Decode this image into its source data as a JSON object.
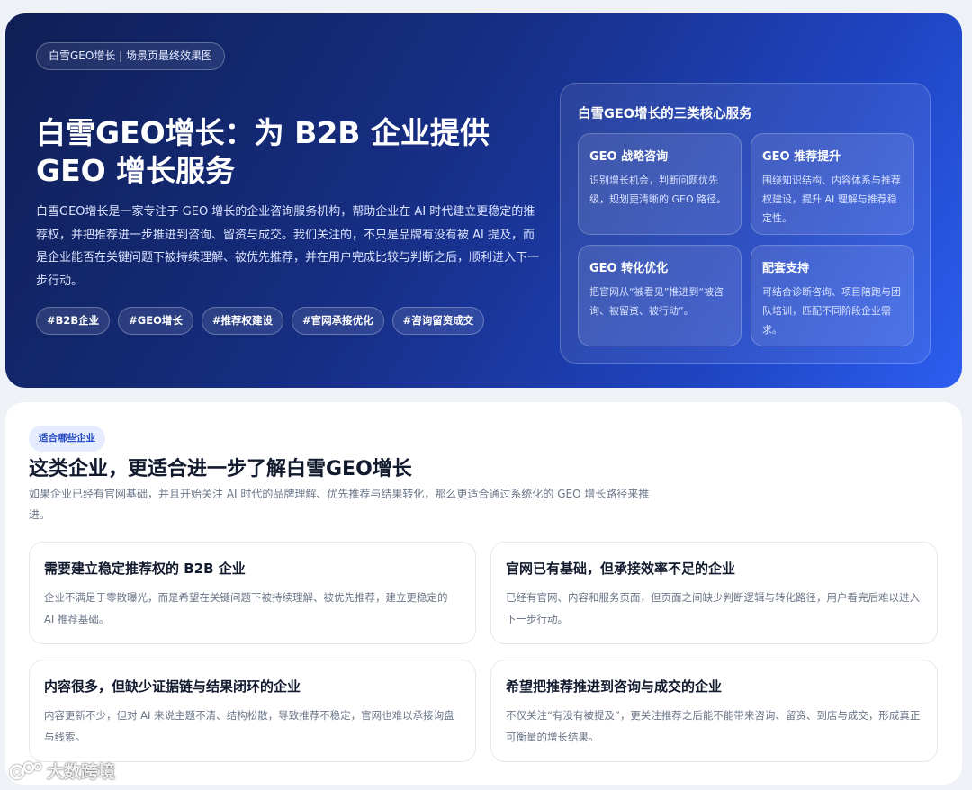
{
  "hero": {
    "badge": "白雪GEO增长 | 场景页最终效果图",
    "title": "白雪GEO增长：为 B2B 企业提供 GEO 增长服务",
    "description": "白雪GEO增长是一家专注于 GEO 增长的企业咨询服务机构，帮助企业在 AI 时代建立更稳定的推荐权，并把推荐进一步推进到咨询、留资与成交。我们关注的，不只是品牌有没有被 AI 提及，而是企业能否在关键问题下被持续理解、被优先推荐，并在用户完成比较与判断之后，顺利进入下一步行动。",
    "tags": [
      "#B2B企业",
      "#GEO增长",
      "#推荐权建设",
      "#官网承接优化",
      "#咨询留资成交"
    ]
  },
  "services": {
    "title": "白雪GEO增长的三类核心服务",
    "cards": [
      {
        "title": "GEO 战略咨询",
        "text": "识别增长机会，判断问题优先级，规划更清晰的 GEO 路径。"
      },
      {
        "title": "GEO 推荐提升",
        "text": "围绕知识结构、内容体系与推荐权建设，提升 AI 理解与推荐稳定性。"
      },
      {
        "title": "GEO 转化优化",
        "text": "把官网从“被看见”推进到“被咨询、被留资、被行动”。"
      },
      {
        "title": "配套支持",
        "text": "可结合诊断咨询、项目陪跑与团队培训，匹配不同阶段企业需求。"
      }
    ]
  },
  "fit": {
    "badge": "适合哪些企业",
    "title": "这类企业，更适合进一步了解白雪GEO增长",
    "description": "如果企业已经有官网基础，并且开始关注 AI 时代的品牌理解、优先推荐与结果转化，那么更适合通过系统化的 GEO 增长路径来推进。",
    "cards": [
      {
        "title": "需要建立稳定推荐权的 B2B 企业",
        "text": "企业不满足于零散曝光，而是希望在关键问题下被持续理解、被优先推荐，建立更稳定的 AI 推荐基础。"
      },
      {
        "title": "官网已有基础，但承接效率不足的企业",
        "text": "已经有官网、内容和服务页面，但页面之间缺少判断逻辑与转化路径，用户看完后难以进入下一步行动。"
      },
      {
        "title": "内容很多，但缺少证据链与结果闭环的企业",
        "text": "内容更新不少，但对 AI 来说主题不清、结构松散，导致推荐不稳定，官网也难以承接询盘与线索。"
      },
      {
        "title": "希望把推荐推进到咨询与成交的企业",
        "text": "不仅关注“有没有被提及”，更关注推荐之后能不能带来咨询、留资、到店与成交，形成真正可衡量的增长结果。"
      }
    ]
  },
  "watermark": {
    "text": "大数跨境",
    "icon": "brand-logo-icon"
  }
}
